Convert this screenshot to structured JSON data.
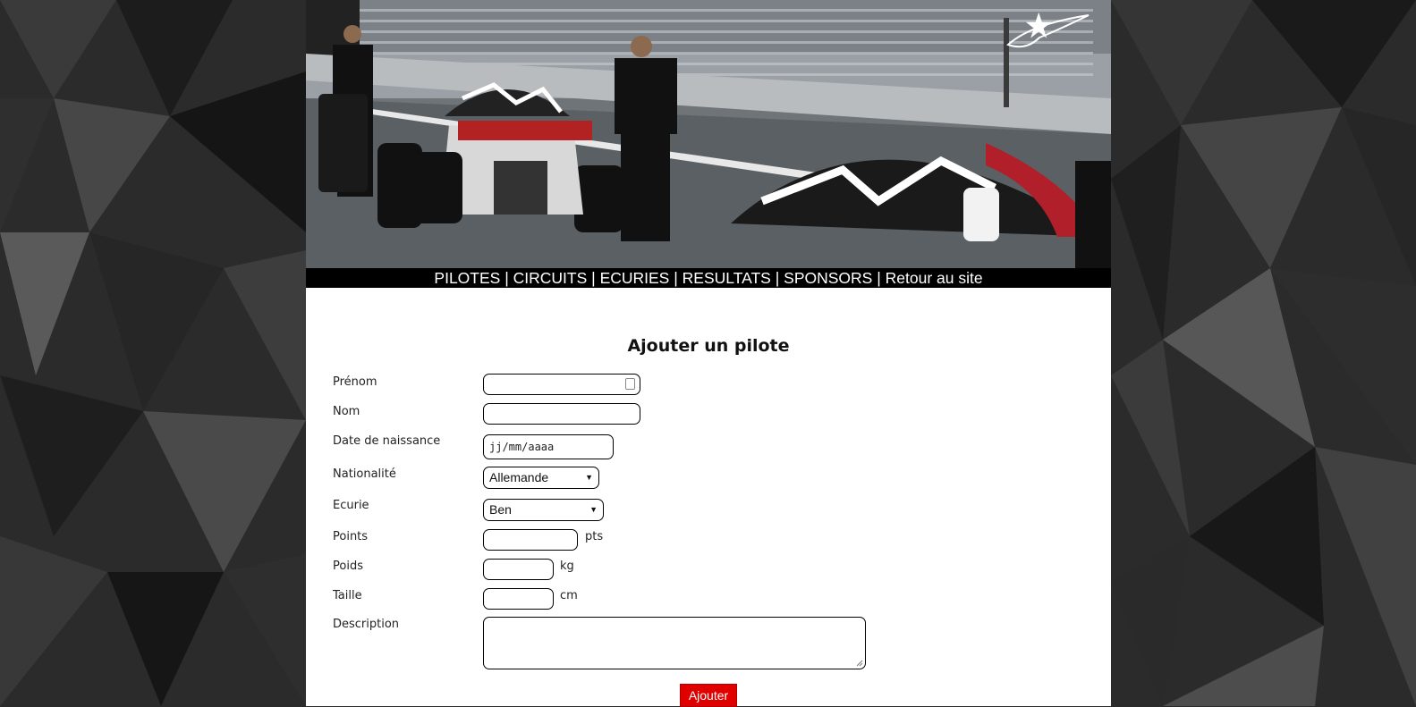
{
  "nav": {
    "items": [
      "PILOTES",
      "CIRCUITS",
      "ECURIES",
      "RESULTATS",
      "SPONSORS",
      "Retour au site"
    ],
    "separator": "|"
  },
  "form": {
    "title": "Ajouter un pilote",
    "fields": {
      "prenom": {
        "label": "Prénom",
        "value": ""
      },
      "nom": {
        "label": "Nom",
        "value": ""
      },
      "date_naissance": {
        "label": "Date de naissance",
        "placeholder": "jj/mm/aaaa"
      },
      "nationalite": {
        "label": "Nationalité",
        "selected": "Allemande"
      },
      "ecurie": {
        "label": "Ecurie",
        "selected": "Ben"
      },
      "points": {
        "label": "Points",
        "unit": "pts"
      },
      "poids": {
        "label": "Poids",
        "unit": "kg"
      },
      "taille": {
        "label": "Taille",
        "unit": "cm"
      },
      "description": {
        "label": "Description",
        "value": ""
      }
    },
    "submit_label": "Ajouter"
  },
  "colors": {
    "accent": "#e00000",
    "nav_bg": "#000000",
    "page_bg": "#2a2a2a"
  },
  "icons": {
    "brand_logo": "star-logo-icon",
    "select_arrow": "triangle-down-icon",
    "autofill": "contact-card-icon"
  }
}
